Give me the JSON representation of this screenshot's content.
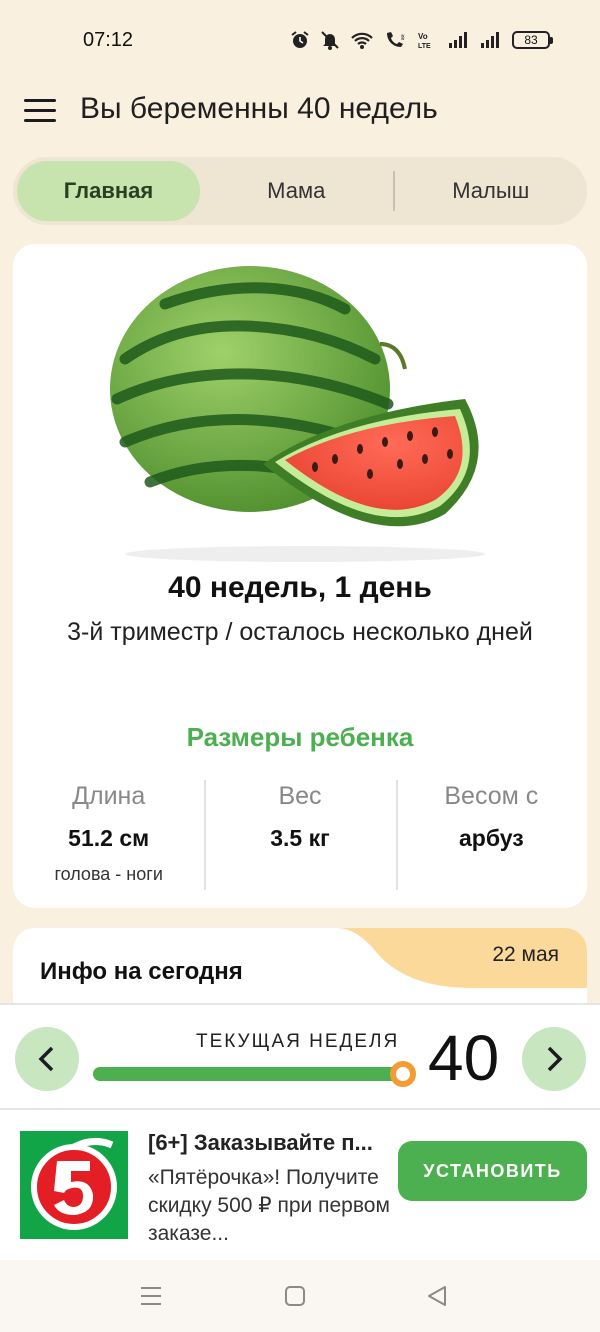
{
  "status_bar": {
    "time": "07:12",
    "battery": "83",
    "icons": [
      "alarm-icon",
      "mute-icon",
      "wifi-icon",
      "wifi-call-icon",
      "volte-icon",
      "signal-icon",
      "signal-icon",
      "battery-icon"
    ]
  },
  "app_bar": {
    "title": "Вы беременны 40 недель",
    "menu_icon": "hamburger-menu-icon"
  },
  "tabs": [
    {
      "label": "Главная",
      "active": true
    },
    {
      "label": "Мама",
      "active": false
    },
    {
      "label": "Малыш",
      "active": false
    }
  ],
  "main_card": {
    "image": "watermelon",
    "week_title": "40 недель, 1 день",
    "trimester": "3-й триместр / осталось несколько дней",
    "sizes_heading": "Размеры ребенка",
    "metrics": [
      {
        "label": "Длина",
        "value": "51.2 см",
        "sub": "голова - ноги"
      },
      {
        "label": "Вес",
        "value": "3.5 кг",
        "sub": ""
      },
      {
        "label": "Весом с",
        "value": "арбуз",
        "sub": ""
      }
    ]
  },
  "info_card": {
    "title": "Инфо на сегодня",
    "date": "22 мая"
  },
  "week_bar": {
    "label": "ТЕКУЩАЯ НЕДЕЛЯ",
    "week": "40",
    "progress": 1.0,
    "accent": "#4caf50",
    "thumb_color": "#f39c34"
  },
  "ad": {
    "title": "[6+] Заказывайте п...",
    "text": "«Пятёрочка»! Получите скидку 500 ₽ при первом заказе...",
    "button": "УСТАНОВИТЬ",
    "logo_text": "5"
  },
  "system_nav": [
    "menu-icon",
    "home-icon",
    "back-icon"
  ]
}
